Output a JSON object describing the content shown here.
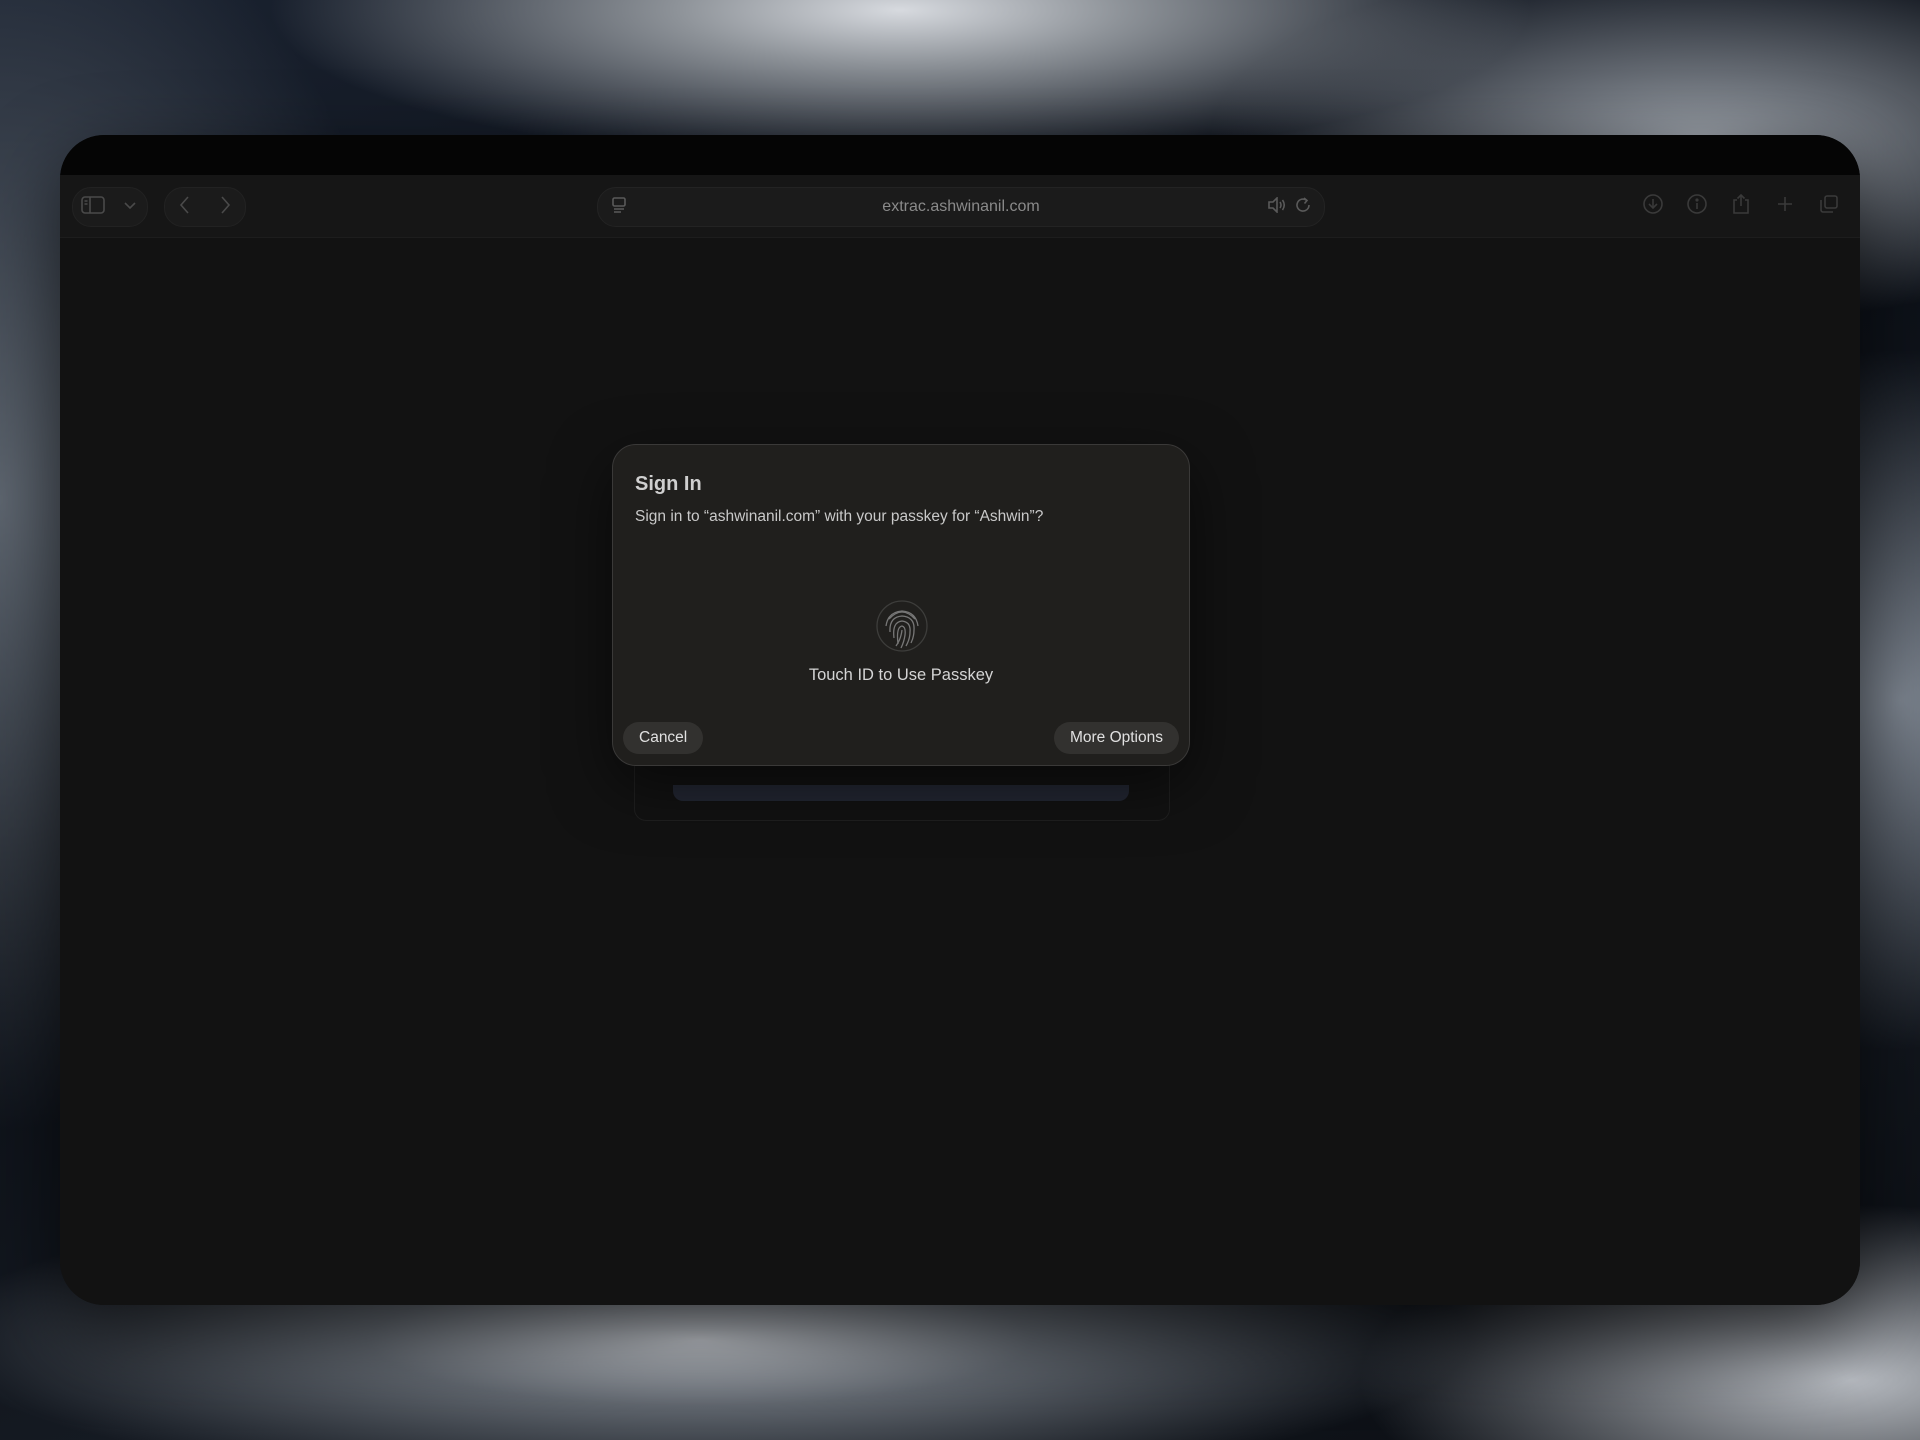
{
  "browser": {
    "url": "extrac.ashwinanil.com"
  },
  "dialog": {
    "title": "Sign In",
    "message": "Sign in to “ashwinanil.com” with your passkey for “Ashwin”?",
    "touch_id_label": "Touch ID to Use Passkey",
    "cancel_label": "Cancel",
    "more_options_label": "More Options"
  },
  "icons": {
    "sidebar": "sidebar-icon",
    "chevron_down": "chevron-down-icon",
    "back": "back-icon",
    "forward": "forward-icon",
    "reader": "reader-icon",
    "audio": "speaker-icon",
    "reload": "reload-icon",
    "downloads": "download-icon",
    "info": "info-icon",
    "share": "share-icon",
    "new_tab": "plus-icon",
    "tabs": "tabs-overview-icon",
    "fingerprint": "fingerprint-icon"
  },
  "colors": {
    "window_bg": "#121212",
    "dialog_bg": "#201f1d",
    "button_bg": "#32312f"
  }
}
